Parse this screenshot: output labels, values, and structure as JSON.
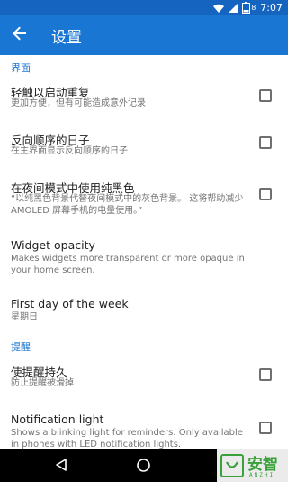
{
  "status_bar": {
    "time": "7:07",
    "battery_level": "8"
  },
  "app_bar": {
    "title": "设置",
    "back_icon": "arrow-back-icon"
  },
  "sections": {
    "interface": "界面",
    "reminders": "提醒"
  },
  "settings": {
    "tap_repeat": {
      "title": "轻触以启动重复",
      "summary": "更加方便，但有可能造成意外记录"
    },
    "reverse_order": {
      "title": "反向顺序的日子",
      "summary": "在主界面显示反向顺序的日子"
    },
    "pure_black": {
      "title": "在夜间模式中使用纯黑色",
      "summary": "“以纯黑色背景代替夜间模式中的灰色背景。 这将帮助减少 AMOLED 屏幕手机的电量使用。”"
    },
    "widget_opacity": {
      "title": "Widget opacity",
      "summary": "Makes widgets more transparent or more opaque in your home screen."
    },
    "first_day": {
      "title": "First day of the week",
      "summary": "星期日"
    },
    "sticky_reminders": {
      "title": "使提醒持久",
      "summary": "防止提醒被滑掉"
    },
    "notification_light": {
      "title": "Notification light",
      "summary": "Shows a blinking light for reminders. Only available in phones with LED notification lights."
    }
  },
  "watermark": {
    "text": "安智",
    "sub": "ANZHI"
  },
  "colors": {
    "primary": "#1976d2",
    "status": "#1565c0",
    "accent": "#1976d2"
  }
}
